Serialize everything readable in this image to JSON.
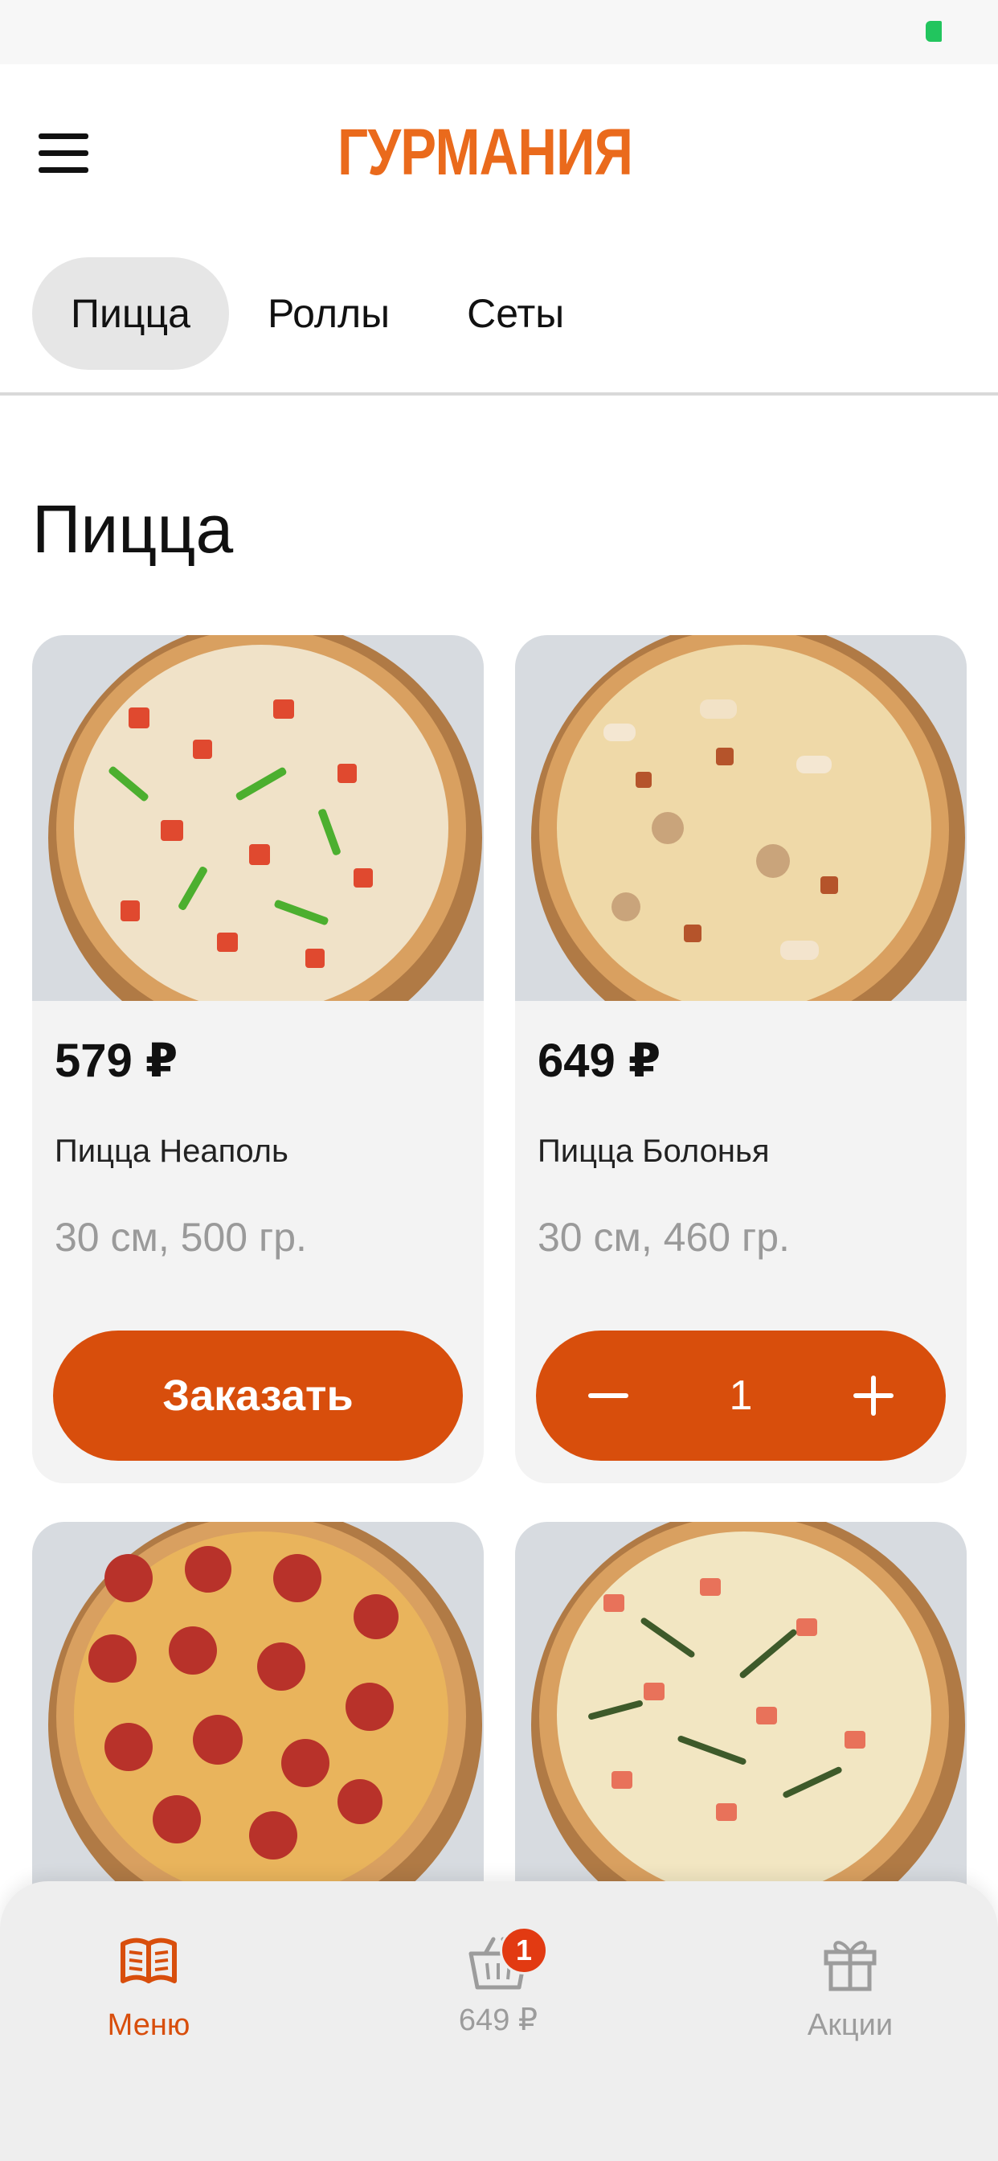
{
  "header": {
    "brand_name": "ГУРМАНИЯ",
    "menu_icon": "hamburger-menu-icon",
    "logo_icon": "cloche-icon",
    "brand_color": "#ea6a1c"
  },
  "tabs": [
    {
      "label": "Пицца",
      "active": true
    },
    {
      "label": "Роллы",
      "active": false
    },
    {
      "label": "Сеты",
      "active": false
    }
  ],
  "section": {
    "title": "Пицца"
  },
  "products": [
    {
      "price": "579 ₽",
      "name": "Пицца Неаполь",
      "weight": "30 см, 500 гр.",
      "action_label": "Заказать",
      "in_cart": false
    },
    {
      "price": "649 ₽",
      "name": "Пицца Болонья",
      "weight": "30 см, 460 гр.",
      "quantity": "1",
      "in_cart": true
    },
    {
      "price": "",
      "name": "",
      "weight": ""
    },
    {
      "price": "",
      "name": "",
      "weight": ""
    }
  ],
  "bottom_nav": {
    "menu_label": "Меню",
    "cart_label": "649 ₽",
    "cart_badge": "1",
    "promo_label": "Акции"
  },
  "colors": {
    "accent": "#d84e0c",
    "active_tab_bg": "#e6e6e6",
    "card_bg": "#f3f3f3"
  }
}
